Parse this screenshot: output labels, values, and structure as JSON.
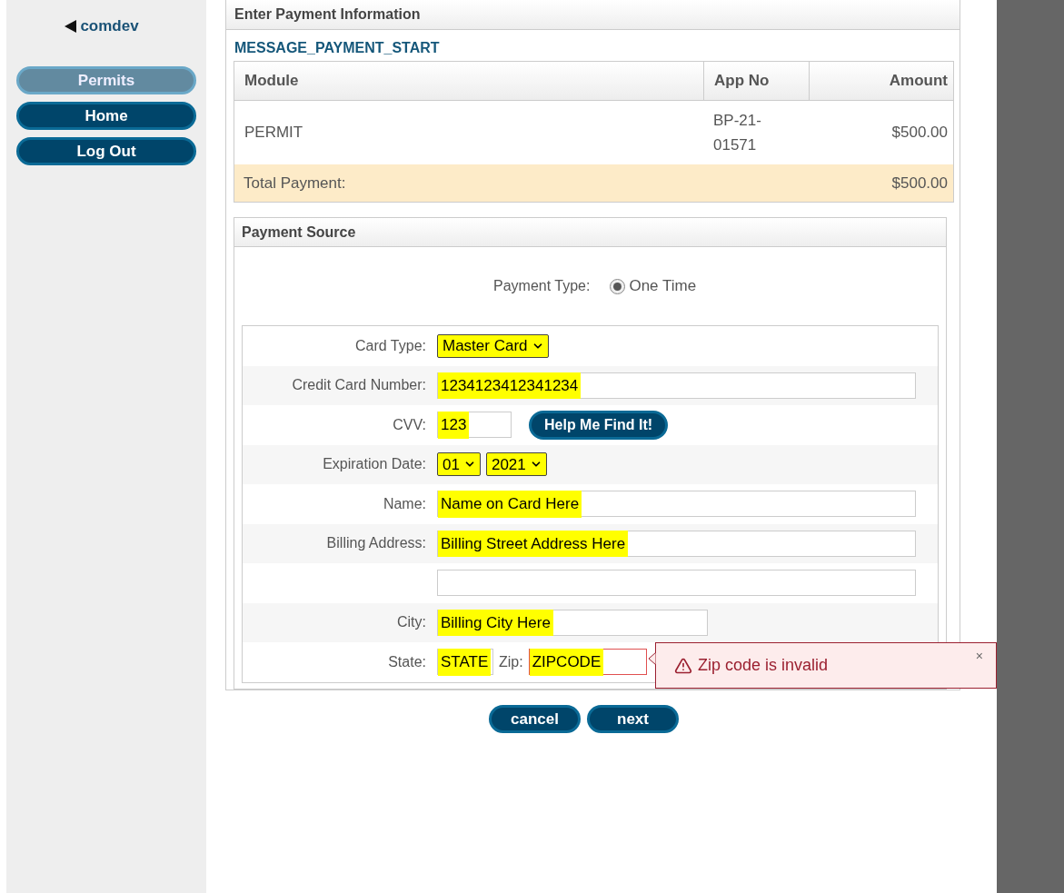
{
  "sidebar": {
    "back_link": "comdev",
    "items": [
      {
        "label": "Permits",
        "selected": true
      },
      {
        "label": "Home",
        "selected": false
      },
      {
        "label": "Log Out",
        "selected": false
      }
    ]
  },
  "panel": {
    "title": "Enter Payment Information",
    "message": "MESSAGE_PAYMENT_START",
    "table": {
      "columns": [
        "Module",
        "App No",
        "Amount"
      ],
      "rows": [
        [
          "PERMIT",
          "BP-21-01571",
          "$500.00"
        ]
      ],
      "total": {
        "label": "Total Payment:",
        "amount": "$500.00"
      }
    },
    "payment_source": {
      "title": "Payment Source",
      "payment_type": {
        "label": "Payment Type:",
        "option": "One Time",
        "selected": true
      },
      "fields": [
        {
          "kind": "select",
          "label": "Card Type:",
          "value": "Master Card",
          "highlighted": true
        },
        {
          "kind": "text",
          "label": "Credit Card Number:",
          "value": "1234123412341234",
          "highlighted": true
        },
        {
          "kind": "cvv",
          "label": "CVV:",
          "value": "123",
          "highlighted": true,
          "button": "Help Me Find It!"
        },
        {
          "kind": "expiry",
          "label": "Expiration Date:",
          "month": "01",
          "year": "2021",
          "highlighted": true
        },
        {
          "kind": "text",
          "label": "Name:",
          "value": "Name on Card Here",
          "highlighted": true
        },
        {
          "kind": "text",
          "label": "Billing Address:",
          "value": "Billing Street Address Here",
          "highlighted": true
        },
        {
          "kind": "text"
        },
        {
          "kind": "short",
          "label": "City:",
          "value": "Billing City Here",
          "highlighted": true
        },
        {
          "kind": "state_zip",
          "label": "State:",
          "value": "STATE",
          "zip_label": "Zip:",
          "zip_value": "ZIPCODE",
          "zip_invalid": true,
          "highlighted": true
        }
      ]
    },
    "error": {
      "message": "Zip code is invalid",
      "close": "×"
    }
  },
  "buttons": [
    "cancel",
    "next"
  ]
}
